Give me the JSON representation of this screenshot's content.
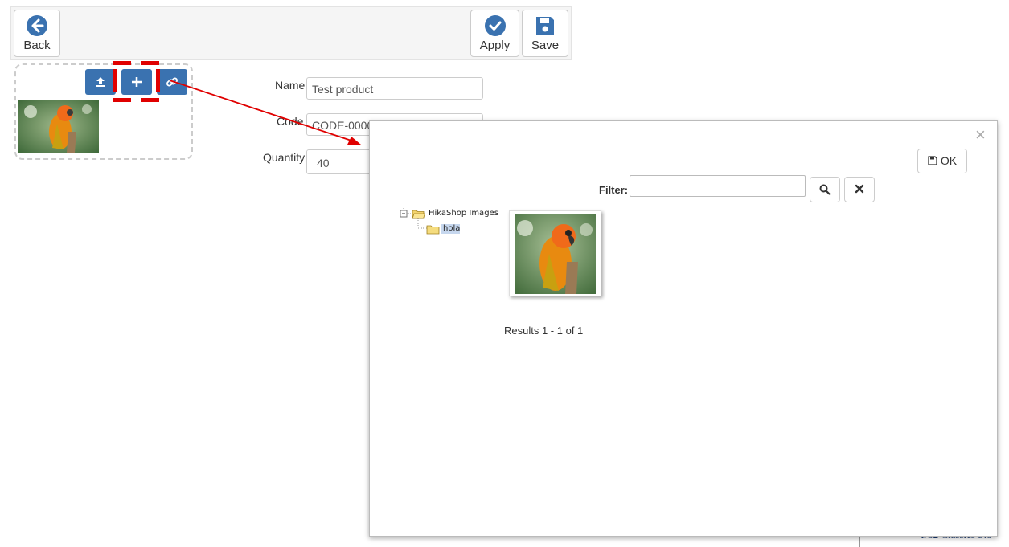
{
  "toolbar": {
    "back_label": "Back",
    "apply_label": "Apply",
    "save_label": "Save"
  },
  "form": {
    "name_label": "Name",
    "name_value": "Test product",
    "code_label": "Code",
    "code_value": "CODE-0000",
    "quantity_label": "Quantity",
    "quantity_value": "40"
  },
  "modal": {
    "ok_label": "OK",
    "filter_label": "Filter:",
    "filter_value": "",
    "tree": {
      "root": "HikaShop Images",
      "child": "hola"
    },
    "results_text": "Results 1 - 1 of 1"
  },
  "background": {
    "list_item": "1/32 Classics Sto"
  },
  "icons": [
    "arrow-left-circle-icon",
    "check-circle-icon",
    "floppy-disk-icon",
    "upload-icon",
    "plus-icon",
    "link-icon",
    "search-icon",
    "times-icon",
    "folder-icon",
    "close-icon"
  ],
  "colors": {
    "accent_blue": "#3a72b0",
    "highlight_red": "#e00000",
    "selected_node": "#c6d7ee"
  }
}
